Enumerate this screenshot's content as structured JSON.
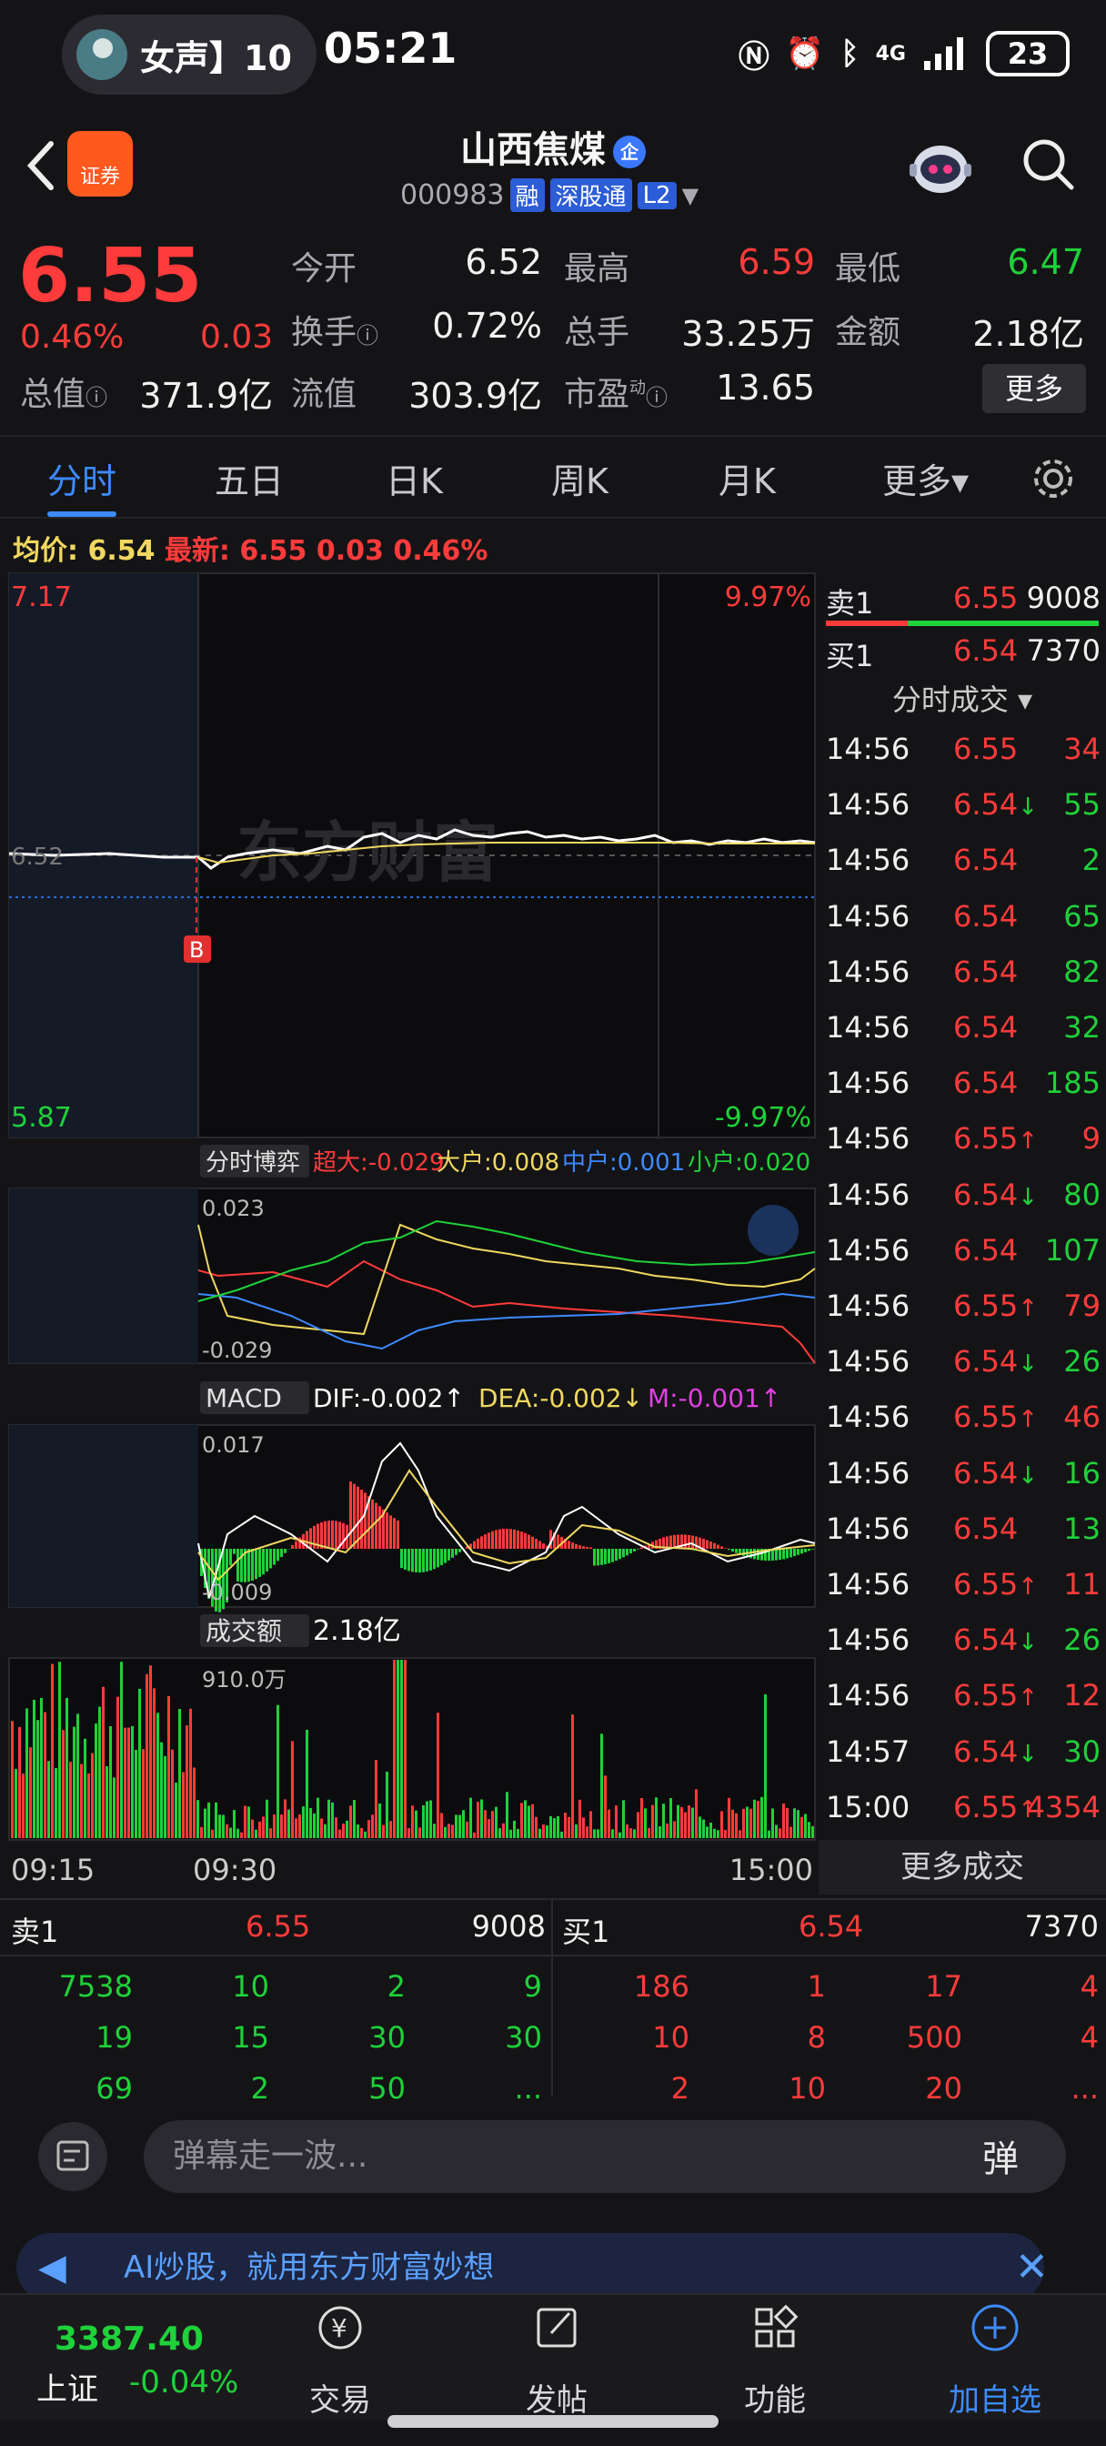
{
  "status": {
    "pill_text": "女声】10",
    "clock": "05:21",
    "network": "4G",
    "battery": "23"
  },
  "header": {
    "logo_text": "证券",
    "stock_name": "山西焦煤",
    "qi_badge": "企",
    "code": "000983",
    "tag_rong": "融",
    "tag_sgt": "深股通",
    "tag_l2": "L2"
  },
  "quote": {
    "price": "6.55",
    "pct": "0.46%",
    "change": "0.03",
    "fields": {
      "open_label": "今开",
      "open": "6.52",
      "high_label": "最高",
      "high": "6.59",
      "low_label": "最低",
      "low": "6.47",
      "turnover_label": "换手",
      "turnover": "0.72%",
      "volume_label": "总手",
      "volume": "33.25万",
      "amount_label": "金额",
      "amount": "2.18亿",
      "mktcap_label": "总值",
      "mktcap": "371.9亿",
      "float_label": "流值",
      "float": "303.9亿",
      "pe_label": "市盈",
      "pe_sup": "动",
      "pe": "13.65"
    },
    "more_button": "更多"
  },
  "tabs": [
    {
      "label": "分时",
      "active": true
    },
    {
      "label": "五日"
    },
    {
      "label": "日K"
    },
    {
      "label": "周K"
    },
    {
      "label": "月K"
    },
    {
      "label": "更多▾"
    }
  ],
  "info_line": {
    "avg_label": "均价:",
    "avg": "6.54",
    "latest_label": "最新:",
    "latest": "6.55",
    "change": "0.03",
    "pct": "0.46%"
  },
  "main_chart": {
    "y_top": "7.17",
    "y_bottom": "5.87",
    "y_mid": "6.52",
    "pct_top": "9.97%",
    "pct_bottom": "-9.97%",
    "marker": "B",
    "watermark": "东方财富",
    "x_start": "09:15",
    "x_mid": "09:30",
    "x_end": "15:00"
  },
  "flow_panel": {
    "title": "分时博弈",
    "super_label": "超大:",
    "super": "-0.029",
    "large_label": "大户:",
    "large": "0.008",
    "medium_label": "中户:",
    "medium": "0.001",
    "small_label": "小户:",
    "small": "0.020",
    "y_top": "0.023",
    "y_bottom": "-0.029"
  },
  "macd_panel": {
    "title": "MACD",
    "dif_label": "DIF:",
    "dif": "-0.002↑",
    "dea_label": "DEA:",
    "dea": "-0.002↓",
    "m_label": "M:",
    "m": "-0.001↑",
    "y_top": "0.017",
    "y_bottom": "-0.009"
  },
  "volume_panel": {
    "title": "成交额",
    "value": "2.18亿",
    "y_top": "910.0万"
  },
  "book": {
    "sell1_label": "卖1",
    "sell1_price": "6.55",
    "sell1_vol": "9008",
    "buy1_label": "买1",
    "buy1_price": "6.54",
    "buy1_vol": "7370"
  },
  "trades_title": "分时成交 ▾",
  "trades": [
    {
      "t": "14:56",
      "p": "6.55",
      "arrow": "",
      "v": "34",
      "pc": "red",
      "vc": "red"
    },
    {
      "t": "14:56",
      "p": "6.54",
      "arrow": "↓",
      "v": "55",
      "pc": "red",
      "vc": "green"
    },
    {
      "t": "14:56",
      "p": "6.54",
      "arrow": "",
      "v": "2",
      "pc": "red",
      "vc": "green"
    },
    {
      "t": "14:56",
      "p": "6.54",
      "arrow": "",
      "v": "65",
      "pc": "red",
      "vc": "green"
    },
    {
      "t": "14:56",
      "p": "6.54",
      "arrow": "",
      "v": "82",
      "pc": "red",
      "vc": "green"
    },
    {
      "t": "14:56",
      "p": "6.54",
      "arrow": "",
      "v": "32",
      "pc": "red",
      "vc": "green"
    },
    {
      "t": "14:56",
      "p": "6.54",
      "arrow": "",
      "v": "185",
      "pc": "red",
      "vc": "green"
    },
    {
      "t": "14:56",
      "p": "6.55",
      "arrow": "↑",
      "v": "9",
      "pc": "red",
      "vc": "red"
    },
    {
      "t": "14:56",
      "p": "6.54",
      "arrow": "↓",
      "v": "80",
      "pc": "red",
      "vc": "green"
    },
    {
      "t": "14:56",
      "p": "6.54",
      "arrow": "",
      "v": "107",
      "pc": "red",
      "vc": "green"
    },
    {
      "t": "14:56",
      "p": "6.55",
      "arrow": "↑",
      "v": "79",
      "pc": "red",
      "vc": "red"
    },
    {
      "t": "14:56",
      "p": "6.54",
      "arrow": "↓",
      "v": "26",
      "pc": "red",
      "vc": "green"
    },
    {
      "t": "14:56",
      "p": "6.55",
      "arrow": "↑",
      "v": "46",
      "pc": "red",
      "vc": "red"
    },
    {
      "t": "14:56",
      "p": "6.54",
      "arrow": "↓",
      "v": "16",
      "pc": "red",
      "vc": "green"
    },
    {
      "t": "14:56",
      "p": "6.54",
      "arrow": "",
      "v": "13",
      "pc": "red",
      "vc": "green"
    },
    {
      "t": "14:56",
      "p": "6.55",
      "arrow": "↑",
      "v": "11",
      "pc": "red",
      "vc": "red"
    },
    {
      "t": "14:56",
      "p": "6.54",
      "arrow": "↓",
      "v": "26",
      "pc": "red",
      "vc": "green"
    },
    {
      "t": "14:56",
      "p": "6.55",
      "arrow": "↑",
      "v": "12",
      "pc": "red",
      "vc": "red"
    },
    {
      "t": "14:57",
      "p": "6.54",
      "arrow": "↓",
      "v": "30",
      "pc": "red",
      "vc": "green"
    },
    {
      "t": "15:00",
      "p": "6.55",
      "arrow": "↑",
      "v": "4354",
      "pc": "red",
      "vc": "red"
    }
  ],
  "more_trades": "更多成交",
  "depth": {
    "sell_label": "卖1",
    "sell_price": "6.55",
    "sell_vol": "9008",
    "buy_label": "买1",
    "buy_price": "6.54",
    "buy_vol": "7370",
    "sell_rows": [
      [
        "7538",
        "10",
        "2",
        "9"
      ],
      [
        "19",
        "15",
        "30",
        "30"
      ],
      [
        "69",
        "2",
        "50",
        "..."
      ]
    ],
    "buy_rows": [
      [
        "186",
        "1",
        "17",
        "4"
      ],
      [
        "10",
        "8",
        "500",
        "4"
      ],
      [
        "2",
        "10",
        "20",
        "..."
      ]
    ]
  },
  "danmu": {
    "placeholder": "弹幕走一波...",
    "button": "弹"
  },
  "ad": {
    "text": "AI炒股，就用东方财富妙想"
  },
  "bottom": {
    "index_value": "3387.40",
    "index_name": "上证",
    "index_pct": "-0.04%",
    "nav_trade": "交易",
    "nav_post": "发帖",
    "nav_func": "功能",
    "nav_add": "加自选"
  },
  "colors": {
    "up": "#ff3b3b",
    "down": "#1fd13a",
    "accent": "#3d8bff",
    "avg_line": "#f0d860"
  }
}
